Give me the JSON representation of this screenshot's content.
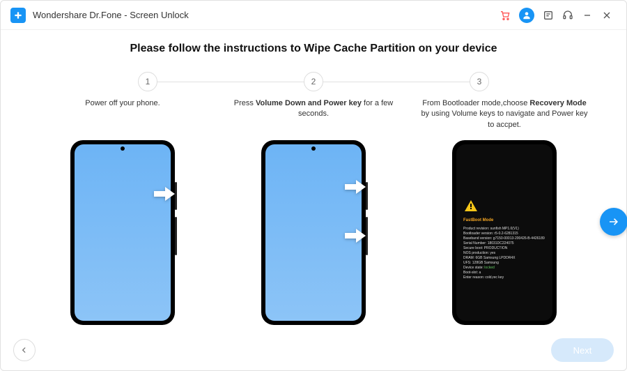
{
  "app": {
    "title": "Wondershare Dr.Fone - Screen Unlock"
  },
  "heading": "Please follow the instructions to Wipe Cache Partition on your device",
  "steps": {
    "n1": "1",
    "n2": "2",
    "n3": "3",
    "c1_text": "Power off your phone.",
    "c2_pre": "Press ",
    "c2_bold": "Volume Down and Power key",
    "c2_post": " for a few seconds.",
    "c3_pre": "From Bootloader mode,choose ",
    "c3_bold": "Recovery Mode",
    "c3_post": " by using Volume keys to navigate and Power key to accpet."
  },
  "boot": {
    "title": "FastBoot Mode",
    "l1": "Product revision: sunfish MP1.0(V1)",
    "l2": "Bootloader version: r5-0.2-6281315",
    "l3": "Baseband version: g7150-00013-200426-B-4426189",
    "l4": "Serial Number: 18031DC224075",
    "l5": "Secure boot: PRODUCTION",
    "l6": "NOS production: yes",
    "l7": "DRAM: 6GB Samsung LPDDR4X",
    "l8": "UFS: 128GB Samsung",
    "l9a": "Device state: ",
    "l9b": "locked",
    "l10": "Boot-slot: a",
    "l11": "Enter reason: cold,rec key"
  },
  "footer": {
    "next": "Next"
  }
}
